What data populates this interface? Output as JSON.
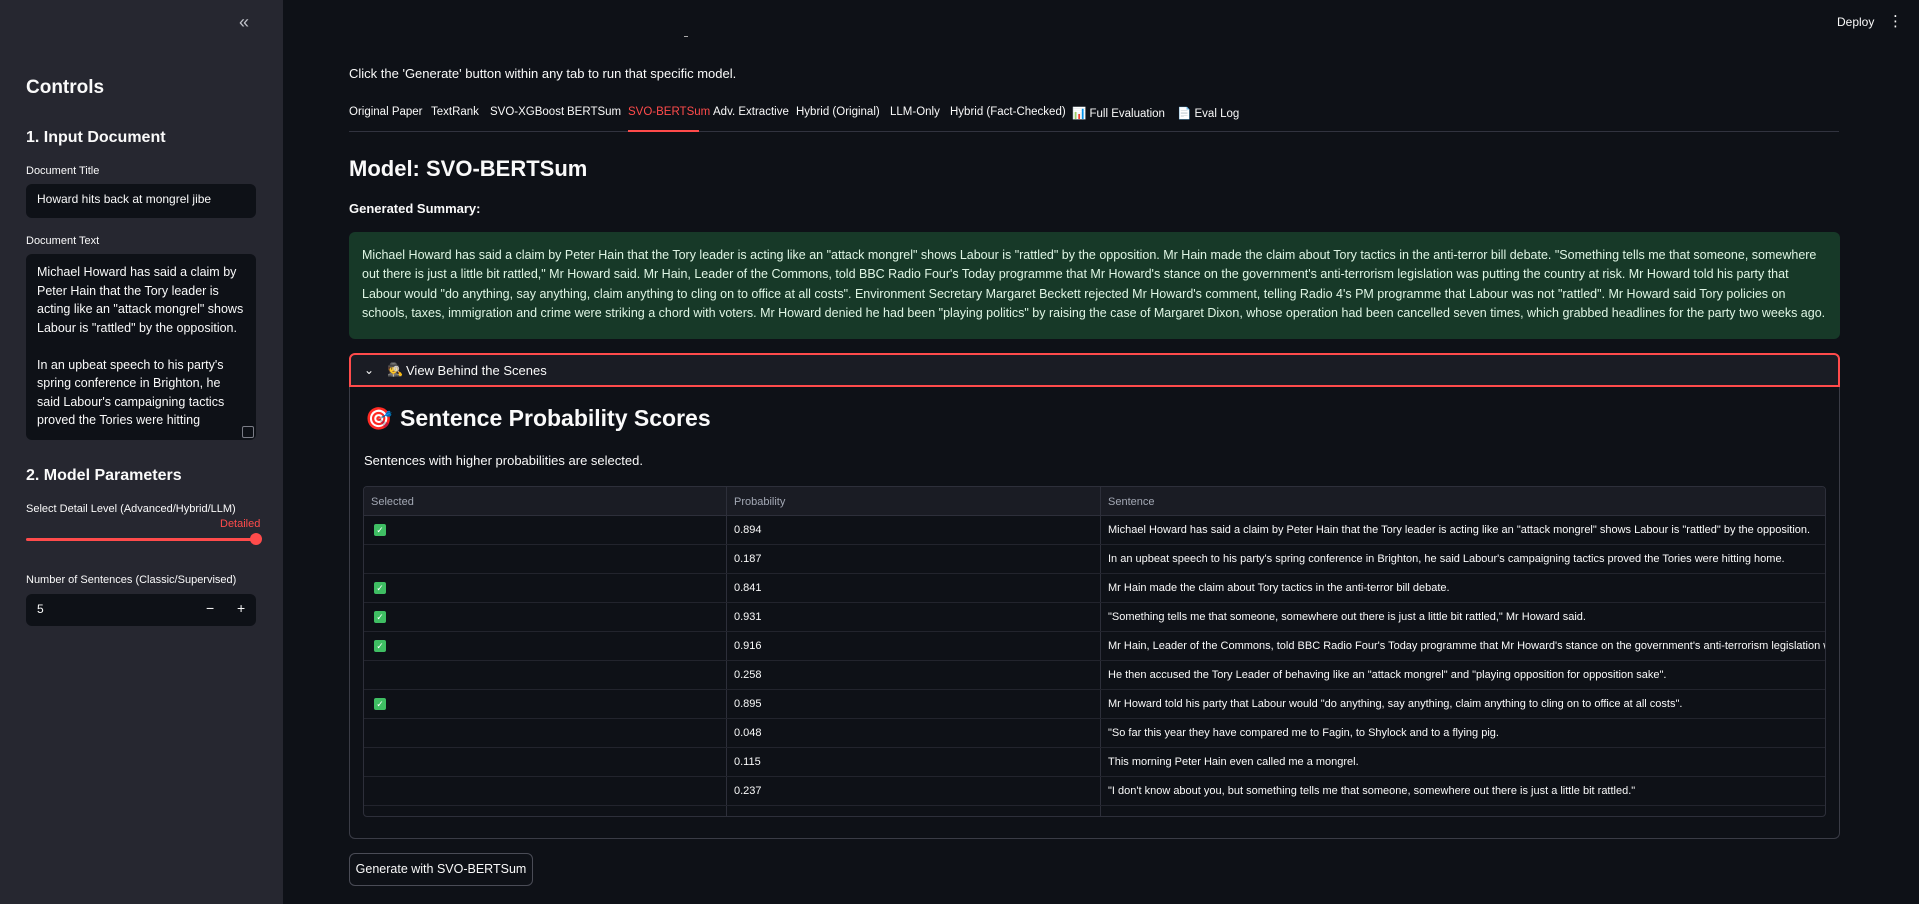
{
  "sidebar": {
    "collapse_icon": "«",
    "title": "Controls",
    "section1": "1. Input Document",
    "doc_title_label": "Document Title",
    "doc_title_value": "Howard hits back at mongrel jibe",
    "doc_text_label": "Document Text",
    "doc_text_value": "Michael Howard has said a claim by Peter Hain that the Tory leader is acting like an \"attack mongrel\" shows Labour is \"rattled\" by the opposition.\n\nIn an upbeat speech to his party's spring conference in Brighton, he said Labour's campaigning tactics proved the Tories were hitting",
    "section2": "2. Model Parameters",
    "detail_label": "Select Detail Level (Advanced/Hybrid/LLM)",
    "detail_value": "Detailed",
    "detail_level_fraction": 1.0,
    "num_sentences_label": "Number of Sentences (Classic/Supervised)",
    "num_sentences_value": "5",
    "minus": "−",
    "plus": "+"
  },
  "topbar": {
    "deploy": "Deploy",
    "menu_icon": "⋮"
  },
  "main": {
    "intro": "Click the 'Generate' button within any tab to run that specific model.",
    "tabs": [
      "Original Paper",
      "TextRank",
      "SVO-XGBoost",
      "BERTSum",
      "SVO-BERTSum",
      "Adv. Extractive",
      "Hybrid (Original)",
      "LLM-Only",
      "Hybrid (Fact-Checked)",
      "📊 Full Evaluation",
      "📄 Eval Log"
    ],
    "active_tab": "SVO-BERTSum",
    "model_title": "Model: SVO-BERTSum",
    "generated_label": "Generated Summary:",
    "summary": "Michael Howard has said a claim by Peter Hain that the Tory leader is acting like an \"attack mongrel\" shows Labour is \"rattled\" by the opposition. Mr Hain made the claim about Tory tactics in the anti-terror bill debate. \"Something tells me that someone, somewhere out there is just a little bit rattled,\" Mr Howard said. Mr Hain, Leader of the Commons, told BBC Radio Four's Today programme that Mr Howard's stance on the government's anti-terrorism legislation was putting the country at risk. Mr Howard told his party that Labour would \"do anything, say anything, claim anything to cling on to office at all costs\". Environment Secretary Margaret Beckett rejected Mr Howard's comment, telling Radio 4's PM programme that Labour was not \"rattled\". Mr Howard said Tory policies on schools, taxes, immigration and crime were striking a chord with voters. Mr Howard denied he had been \"playing politics\" by raising the case of Margaret Dixon, whose operation had been cancelled seven times, which grabbed headlines for the party two weeks ago.",
    "expander": {
      "icon": "🕵",
      "label": "View Behind the Scenes",
      "chevron": "⌄"
    },
    "scores_icon": "🎯",
    "scores_title": "Sentence Probability Scores",
    "scores_sub": "Sentences with higher probabilities are selected.",
    "table": {
      "headers": [
        "Selected",
        "Probability",
        "Sentence"
      ],
      "rows": [
        {
          "selected": true,
          "probability": "0.894",
          "sentence": "Michael Howard has said a claim by Peter Hain that the Tory leader is acting like an \"attack mongrel\" shows Labour is \"rattled\" by the opposition."
        },
        {
          "selected": false,
          "probability": "0.187",
          "sentence": "In an upbeat speech to his party's spring conference in Brighton, he said Labour's campaigning tactics proved the Tories were hitting home."
        },
        {
          "selected": true,
          "probability": "0.841",
          "sentence": "Mr Hain made the claim about Tory tactics in the anti-terror bill debate."
        },
        {
          "selected": true,
          "probability": "0.931",
          "sentence": "\"Something tells me that someone, somewhere out there is just a little bit rattled,\" Mr Howard said."
        },
        {
          "selected": true,
          "probability": "0.916",
          "sentence": "Mr Hain, Leader of the Commons, told BBC Radio Four's Today programme that Mr Howard's stance on the government's anti-terrorism legislation w"
        },
        {
          "selected": false,
          "probability": "0.258",
          "sentence": "He then accused the Tory Leader of behaving like an \"attack mongrel\" and \"playing opposition for opposition sake\"."
        },
        {
          "selected": true,
          "probability": "0.895",
          "sentence": "Mr Howard told his party that Labour would \"do anything, say anything, claim anything to cling on to office at all costs\"."
        },
        {
          "selected": false,
          "probability": "0.048",
          "sentence": "\"So far this year they have compared me to Fagin, to Shylock and to a flying pig."
        },
        {
          "selected": false,
          "probability": "0.115",
          "sentence": "This morning Peter Hain even called me a mongrel."
        },
        {
          "selected": false,
          "probability": "0.237",
          "sentence": "\"I don't know about you, but something tells me that someone, somewhere out there is just a little bit rattled.\""
        }
      ]
    },
    "generate_button": "Generate with SVO-BERTSum"
  }
}
